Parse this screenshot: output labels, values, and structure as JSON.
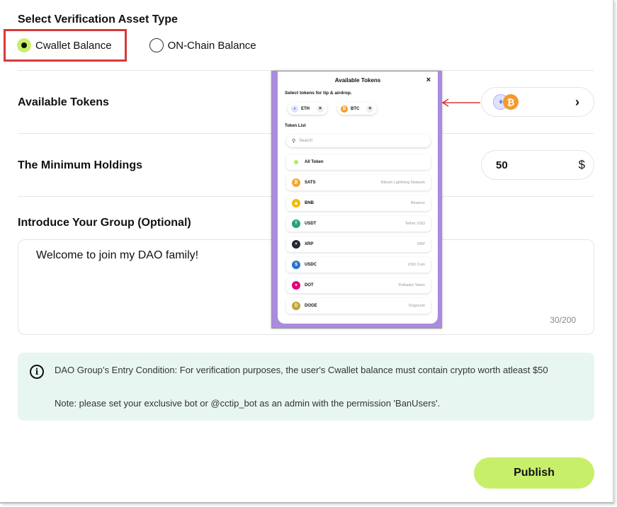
{
  "title": "Select Verification Asset Type",
  "asset_type": {
    "options": [
      {
        "label": "Cwallet Balance",
        "selected": true
      },
      {
        "label": "ON-Chain Balance",
        "selected": false
      }
    ]
  },
  "available_tokens": {
    "label": "Available Tokens",
    "icons": [
      "eth-icon",
      "btc-icon"
    ]
  },
  "min_holdings": {
    "label": "The Minimum Holdings",
    "value": "50",
    "currency": "$"
  },
  "introduce": {
    "label": "Introduce Your Group (Optional)",
    "text": "Welcome to join my DAO family!",
    "count": "30/200"
  },
  "note": {
    "main": "DAO Group’s Entry Condition: For verification purposes, the user's Cwallet balance must contain crypto worth atleast $50",
    "sub": "Note: please set your exclusive bot or @cctip_bot as an admin with the permission 'BanUsers'."
  },
  "publish_label": "Publish",
  "popup": {
    "title": "Available Tokens",
    "close": "×",
    "subtitle": "Select tokens for tip & airdrop.",
    "selected_chips": [
      {
        "symbol": "ETH",
        "color": "#dfe3ff"
      },
      {
        "symbol": "BTC",
        "color": "#f29a2e"
      }
    ],
    "list_label": "Token List",
    "search_placeholder": "Search",
    "all_token_label": "All Token",
    "tokens": [
      {
        "symbol": "SATS",
        "name": "Bitcoin Lightning Network",
        "color": "#f2a72e"
      },
      {
        "symbol": "BNB",
        "name": "Binance",
        "color": "#f0b90b"
      },
      {
        "symbol": "USDT",
        "name": "Tether USD",
        "color": "#26a17b"
      },
      {
        "symbol": "XRP",
        "name": "XRP",
        "color": "#23292f"
      },
      {
        "symbol": "USDC",
        "name": "USD Coin",
        "color": "#2775ca"
      },
      {
        "symbol": "DOT",
        "name": "Polkadot Token",
        "color": "#e6007a"
      },
      {
        "symbol": "DOGE",
        "name": "Dogecoin",
        "color": "#c2a633"
      }
    ]
  },
  "colors": {
    "accent": "#c8ef6a",
    "highlight_border": "#d63a3a",
    "note_bg": "#e7f6f1",
    "popup_bg": "#a98be0"
  }
}
